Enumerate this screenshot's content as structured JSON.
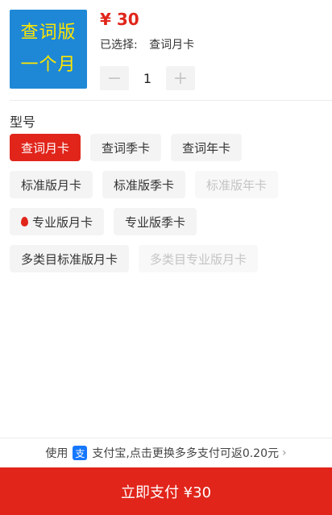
{
  "product": {
    "thumb_line1": "查词版",
    "thumb_line2": "一个月",
    "price": "¥ 30",
    "selected_label": "已选择:",
    "selected_value": "查词月卡",
    "quantity": "1",
    "minus_glyph": "−",
    "plus_glyph": "+"
  },
  "section": {
    "title": "型号"
  },
  "options": [
    [
      {
        "label": "查词月卡",
        "state": "active"
      },
      {
        "label": "查词季卡",
        "state": "normal"
      },
      {
        "label": "查词年卡",
        "state": "normal"
      }
    ],
    [
      {
        "label": "标准版月卡",
        "state": "normal"
      },
      {
        "label": "标准版季卡",
        "state": "normal"
      },
      {
        "label": "标准版年卡",
        "state": "disabled"
      }
    ],
    [
      {
        "label": "专业版月卡",
        "state": "normal",
        "icon": "flame-icon"
      },
      {
        "label": "专业版季卡",
        "state": "normal"
      }
    ],
    [
      {
        "label": "多类目标准版月卡",
        "state": "normal"
      },
      {
        "label": "多类目专业版月卡",
        "state": "disabled"
      }
    ]
  ],
  "footer": {
    "prefix": "使用",
    "alipay_glyph": "支",
    "text": "支付宝,点击更换多多支付可返0.20元",
    "chevron": "›"
  },
  "pay_button": {
    "label": "立即支付 ¥30"
  },
  "colors": {
    "accent": "#e1251b",
    "thumb_bg": "#1e88d6",
    "thumb_text": "#ffe500",
    "alipay": "#1677ff"
  }
}
